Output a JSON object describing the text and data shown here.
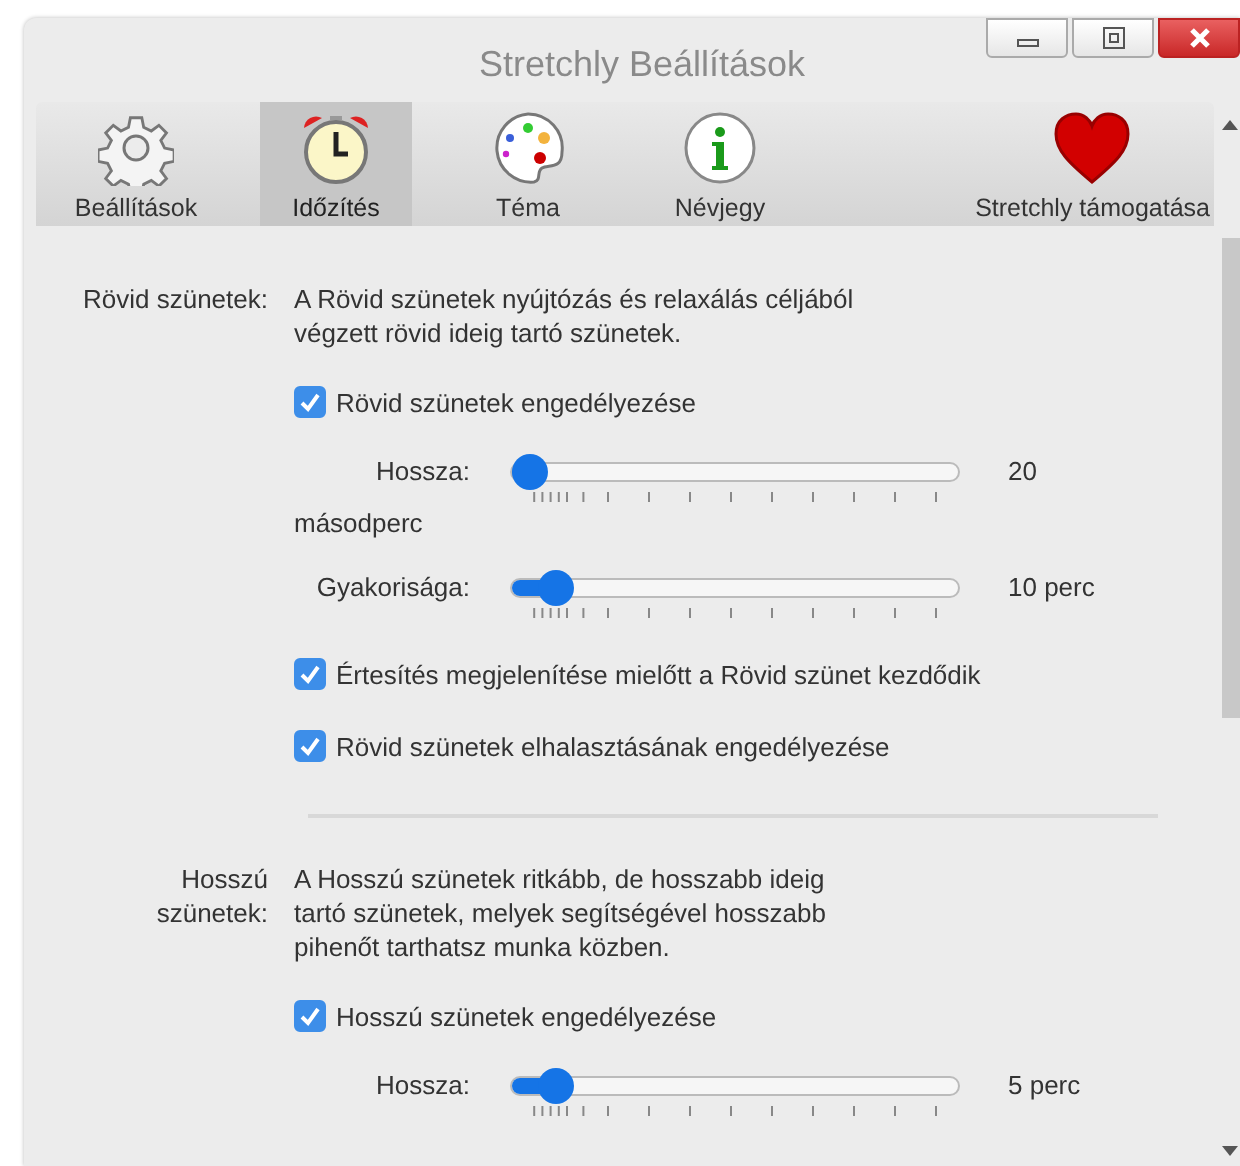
{
  "window": {
    "title": "Stretchly Beállítások"
  },
  "tabs": [
    {
      "label": "Beállítások",
      "kind": "gear",
      "selected": false
    },
    {
      "label": "Időzítés",
      "kind": "clock",
      "selected": true
    },
    {
      "label": "Téma",
      "kind": "palette",
      "selected": false
    },
    {
      "label": "Névjegy",
      "kind": "info",
      "selected": false
    },
    {
      "label": "Stretchly támogatása",
      "kind": "heart",
      "selected": false
    }
  ],
  "sections": [
    {
      "label": "Rövid szünetek:",
      "description": "A Rövid szünetek nyújtózás és relaxálás céljából végzett rövid ideig tartó szünetek.",
      "items": [
        {
          "kind": "checkbox",
          "label": "Rövid szünetek engedélyezése",
          "checked": true
        },
        {
          "kind": "slider",
          "label": "Hossza:",
          "level": 0.04,
          "reading": "20",
          "reading_wrap": "másodperc"
        },
        {
          "kind": "slider",
          "label": "Gyakorisága:",
          "level": 0.1,
          "reading": "10 perc"
        },
        {
          "kind": "checkbox",
          "label": "Értesítés megjelenítése mielőtt a Rövid szünet kezdődik",
          "checked": true
        },
        {
          "kind": "checkbox",
          "label": "Rövid szünetek elhalasztásának engedélyezése",
          "checked": true
        }
      ]
    },
    {
      "label": "Hosszú szünetek:",
      "description": "A Hosszú szünetek ritkább, de hosszabb ideig tartó szünetek, melyek segítségével hosszabb pihenőt tarthatsz munka közben.",
      "items": [
        {
          "kind": "checkbox",
          "label": "Hosszú szünetek engedélyezése",
          "checked": true
        },
        {
          "kind": "slider",
          "label": "Hossza:",
          "level": 0.1,
          "reading": "5 perc"
        }
      ]
    }
  ]
}
